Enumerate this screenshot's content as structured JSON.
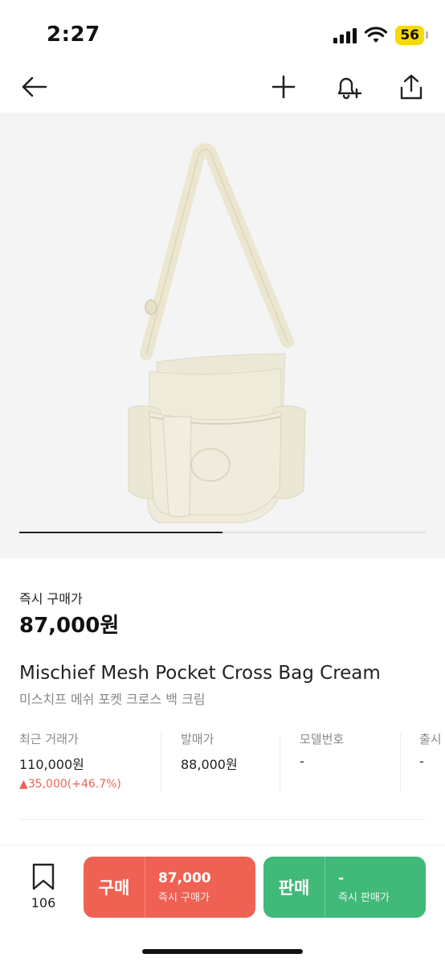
{
  "status": {
    "time": "2:27",
    "battery": "56"
  },
  "nav": {
    "icons": [
      "back-arrow-icon",
      "plus-icon",
      "bell-plus-icon",
      "share-icon"
    ]
  },
  "product": {
    "instant_buy_label": "즉시 구매가",
    "instant_buy_price": "87,000원",
    "name_en": "Mischief Mesh Pocket Cross Bag Cream",
    "name_ko": "미스치프 메쉬 포켓 크로스 백 크림",
    "image_slide_progress": 0.5
  },
  "info": {
    "recent": {
      "label": "최근 거래가",
      "value": "110,000원",
      "change": "▲35,000(+46.7%)"
    },
    "release_price": {
      "label": "발매가",
      "value": "88,000원"
    },
    "model_no": {
      "label": "모델번호",
      "value": "-"
    },
    "release_date": {
      "label": "출시",
      "value": "-"
    }
  },
  "bottom": {
    "wish_count": "106",
    "buy": {
      "label": "구매",
      "amount": "87,000",
      "sub": "즉시 구매가"
    },
    "sell": {
      "label": "판매",
      "amount": "-",
      "sub": "즉시 판매가"
    }
  },
  "colors": {
    "buy": "#ef6253",
    "sell": "#41b979",
    "rise": "#ef6253"
  }
}
